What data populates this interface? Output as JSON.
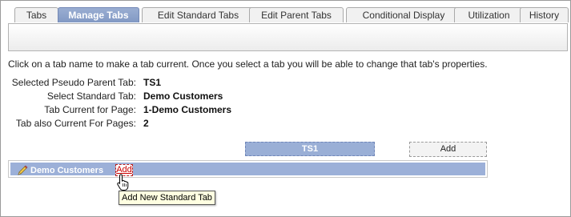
{
  "tabs": [
    {
      "label": "Tabs",
      "active": false
    },
    {
      "label": "Manage Tabs",
      "active": true
    },
    {
      "label": "Edit Standard Tabs",
      "active": false
    },
    {
      "label": "Edit Parent Tabs",
      "active": false
    },
    {
      "label": "Conditional Display",
      "active": false
    },
    {
      "label": "Utilization",
      "active": false
    },
    {
      "label": "History",
      "active": false
    }
  ],
  "instruction": "Click on a tab name to make a tab current. Once you select a tab you will be able to change that tab's properties.",
  "properties": [
    {
      "label": "Selected Pseudo Parent Tab:",
      "value": "TS1"
    },
    {
      "label": "Select Standard Tab:",
      "value": "Demo Customers"
    },
    {
      "label": "Tab Current for Page:",
      "value": "1-Demo Customers"
    },
    {
      "label": "Tab also Current For Pages:",
      "value": "2"
    }
  ],
  "grid": {
    "parent_tab": "TS1",
    "add_parent_label": "Add",
    "standard_tab": "Demo Customers",
    "add_standard_label": "Add"
  },
  "tooltip": "Add New Standard Tab",
  "icons": {
    "pencil": "pencil-icon",
    "cursor": "hand-pointer-icon"
  },
  "colors": {
    "active_tab": "#8aa0c9",
    "row_fill": "#9cb0d8",
    "link_red": "#cc0000",
    "tooltip_bg": "#ffffe1"
  }
}
